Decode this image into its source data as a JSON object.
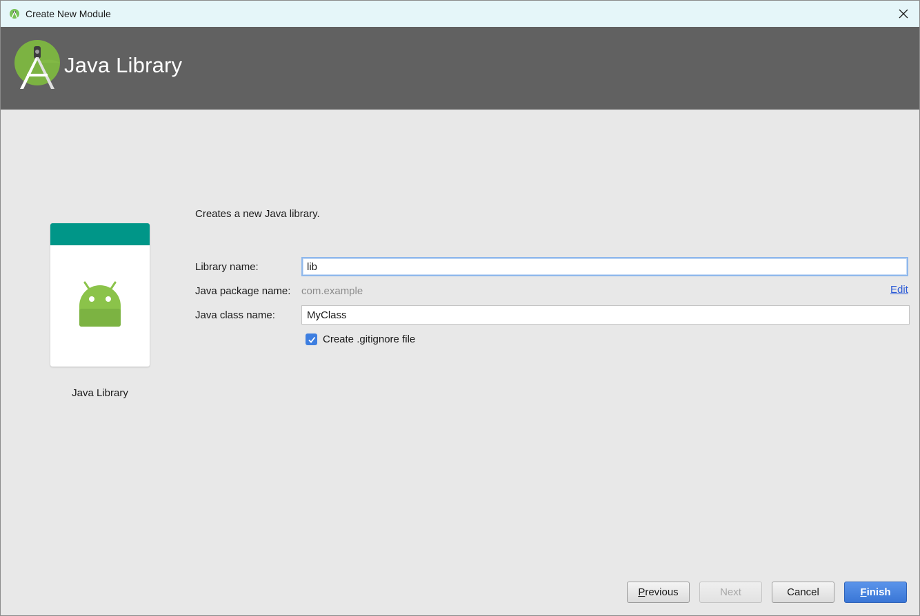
{
  "window": {
    "title": "Create New Module",
    "close_glyph": "✕"
  },
  "banner": {
    "heading": "Java Library",
    "logo_icon": "android-studio-logo-icon"
  },
  "template_card": {
    "caption": "Java Library",
    "header_color": "#009688",
    "icon": "android-robot-icon",
    "icon_color": "#8bc34a"
  },
  "form": {
    "description": "Creates a new Java library.",
    "library_name_label": "Library name:",
    "library_name_value": "lib",
    "package_name_label": "Java package name:",
    "package_name_value": "com.example",
    "edit_link": "Edit",
    "class_name_label": "Java class name:",
    "class_name_value": "MyClass",
    "gitignore_label": "Create .gitignore file",
    "gitignore_checked": true
  },
  "buttons": {
    "previous_mnemonic": "P",
    "previous_rest": "revious",
    "next_label": "Next",
    "cancel_label": "Cancel",
    "finish_mnemonic": "F",
    "finish_rest": "inish"
  },
  "colors": {
    "banner_bg": "#616161",
    "titlebar_bg": "#e5f6f9",
    "accent_blue": "#3d7ee0"
  }
}
